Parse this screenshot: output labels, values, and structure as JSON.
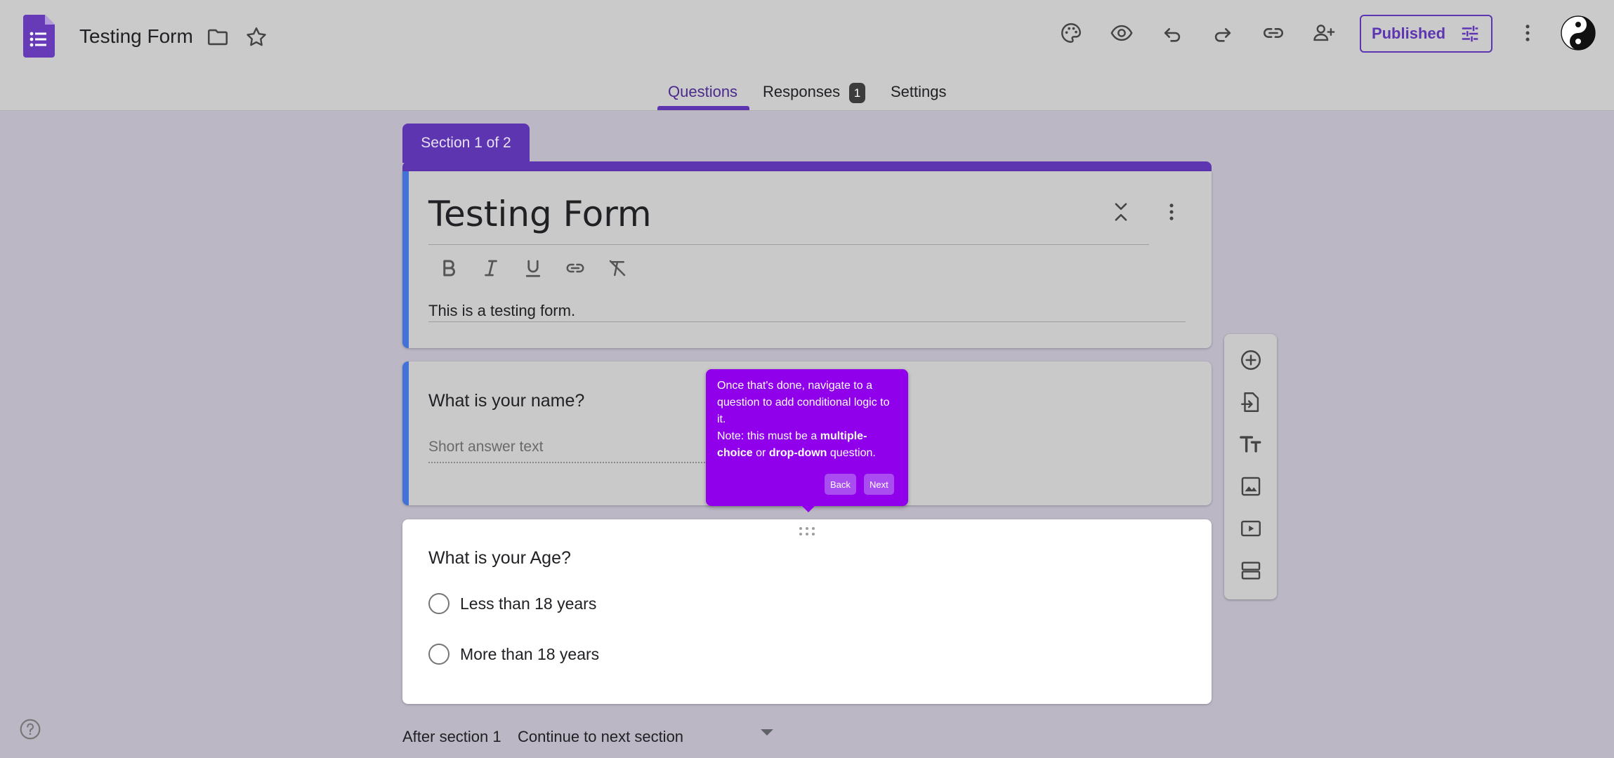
{
  "header": {
    "title": "Testing Form",
    "published_label": "Published",
    "icons": [
      "forms-logo-icon",
      "folder-icon",
      "star-icon",
      "palette-icon",
      "preview-eye-icon",
      "undo-icon",
      "redo-icon",
      "link-icon",
      "add-collaborator-icon",
      "published-settings-icon",
      "more-vert-icon",
      "avatar-yin-yang-icon"
    ]
  },
  "tabs": [
    {
      "label": "Questions",
      "active": true
    },
    {
      "label": "Responses",
      "badge": "1"
    },
    {
      "label": "Settings"
    }
  ],
  "section": {
    "tag": "Section 1 of 2",
    "title": "Testing Form",
    "description": "This is a testing form.",
    "format_icons": [
      "bold-icon",
      "italic-icon",
      "underline-icon",
      "link-icon",
      "clear-format-icon"
    ]
  },
  "questions": [
    {
      "title": "What is your name?",
      "placeholder": "Short answer text"
    },
    {
      "title": "What is your Age?",
      "options": [
        "Less than 18 years",
        "More than 18 years"
      ]
    }
  ],
  "after_section": {
    "label": "After section 1",
    "value": "Continue to next section"
  },
  "tooltip": {
    "line1": "Once that's done, navigate to a question to add conditional logic to it.",
    "note_prefix": "Note: this must be a ",
    "bold1": "multiple-choice",
    "middle": " or ",
    "bold2": "drop-down",
    "suffix": " question.",
    "back": "Back",
    "next": "Next"
  },
  "side_toolbar": [
    "add-question-icon",
    "import-questions-icon",
    "add-title-icon",
    "add-image-icon",
    "add-video-icon",
    "add-section-icon"
  ],
  "colors": {
    "accent": "#5e35b1",
    "tooltip": "#9000ea",
    "left_accent": "#4272d7"
  }
}
